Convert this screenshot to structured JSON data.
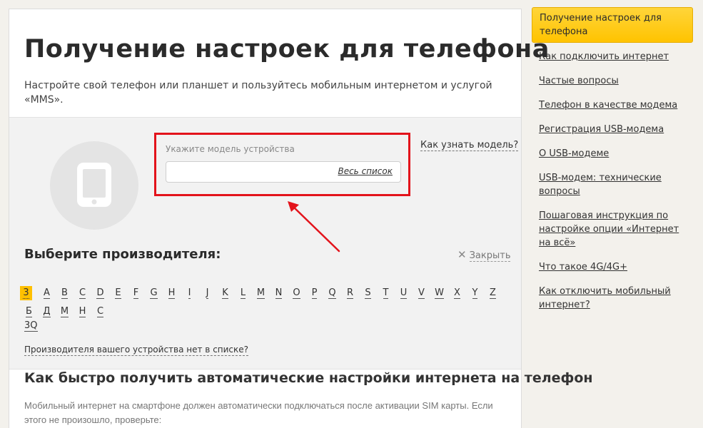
{
  "header": {
    "title": "Получение настроек для телефона",
    "subtitle": "Настройте свой телефон или планшет и пользуйтесь мобильным интернетом и услугой «MMS»."
  },
  "search": {
    "label": "Укажите модель устройства",
    "placeholder": "",
    "full_list_label": "Весь список",
    "model_help_link": "Как узнать модель?"
  },
  "manufacturers": {
    "heading": "Выберите производителя:",
    "close_label": "Закрыть",
    "letters_latin": [
      "3",
      "A",
      "B",
      "C",
      "D",
      "E",
      "F",
      "G",
      "H",
      "I",
      "J",
      "K",
      "L",
      "M",
      "N",
      "O",
      "P",
      "Q",
      "R",
      "S",
      "T",
      "U",
      "V",
      "W",
      "X",
      "Y",
      "Z"
    ],
    "letters_cyrillic": [
      "Б",
      "Д",
      "М",
      "Н",
      "С"
    ],
    "active_letter": "3",
    "brands": [
      "3Q"
    ],
    "not_found_link": "Производителя вашего устройства нет в списке?"
  },
  "section": {
    "title": "Как быстро получить автоматические настройки интернета на телефон",
    "text": "Мобильный интернет на смартфоне должен автоматически подключаться после активации SIM карты. Если этого не произошло, проверьте:"
  },
  "sidebar": {
    "active": "Получение настроек для телефона",
    "items": [
      "Как подключить интернет",
      "Частые вопросы",
      "Телефон в качестве модема",
      "Регистрация USB-модема",
      "О USB-модеме",
      "USB-модем: технические вопросы",
      "Пошаговая инструкция по настройке опции «Интернет на всё»",
      "Что такое 4G/4G+",
      "Как отключить мобильный интернет?"
    ]
  },
  "colors": {
    "accent": "#ffc000",
    "highlight": "#e3131b"
  },
  "icons": [
    "phone-icon",
    "close-icon",
    "arrow-annotation"
  ]
}
